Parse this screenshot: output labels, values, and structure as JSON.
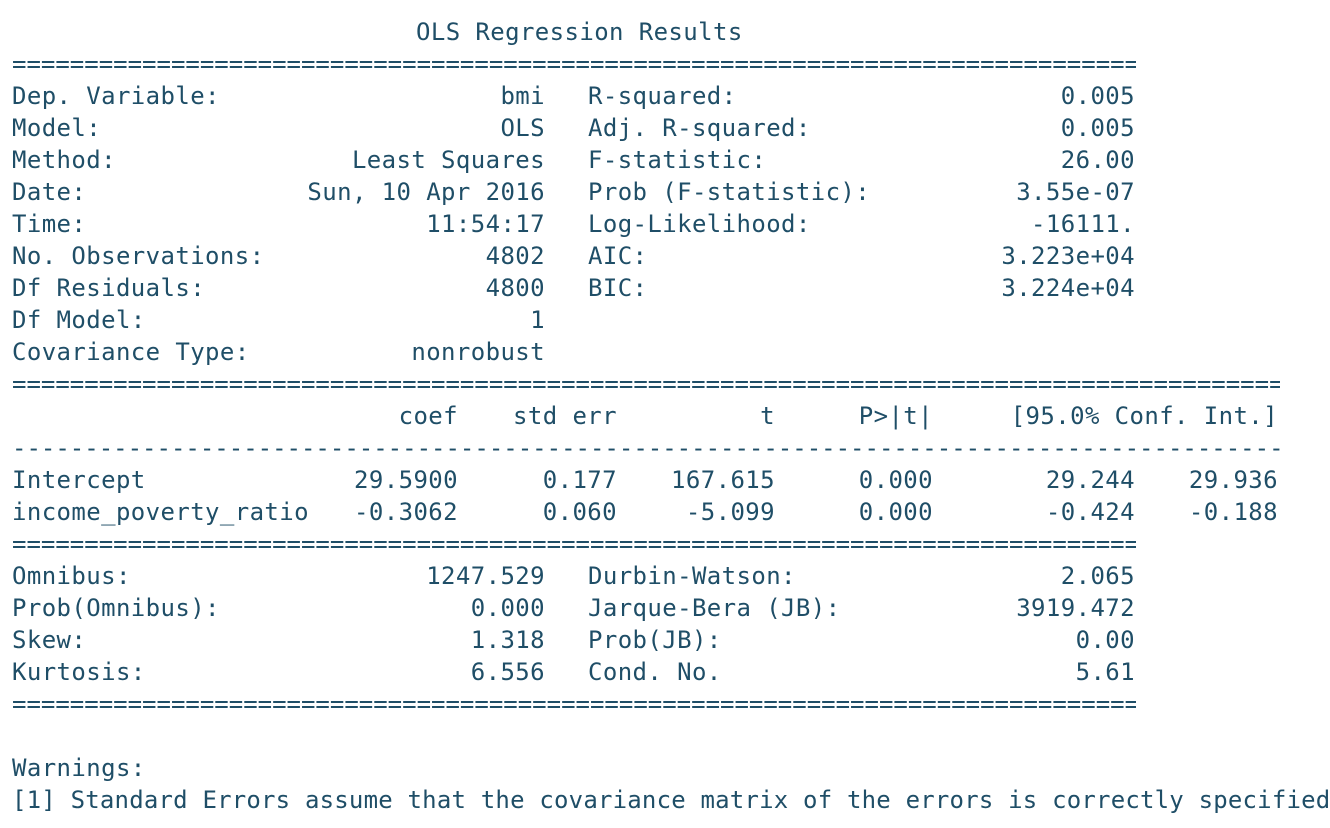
{
  "title": "OLS Regression Results",
  "separators": {
    "double_short": "==============================================================================",
    "double_long": "=========================================================================================",
    "dash_long": "-----------------------------------------------------------------------------------------"
  },
  "model_info": {
    "rows": [
      {
        "label": "Dep. Variable:",
        "value": "bmi",
        "stat_label": "R-squared:",
        "stat_value": "0.005"
      },
      {
        "label": "Model:",
        "value": "OLS",
        "stat_label": "Adj. R-squared:",
        "stat_value": "0.005"
      },
      {
        "label": "Method:",
        "value": "Least Squares",
        "stat_label": "F-statistic:",
        "stat_value": "26.00"
      },
      {
        "label": "Date:",
        "value": "Sun, 10 Apr 2016",
        "stat_label": "Prob (F-statistic):",
        "stat_value": "3.55e-07"
      },
      {
        "label": "Time:",
        "value": "11:54:17",
        "stat_label": "Log-Likelihood:",
        "stat_value": "-16111."
      },
      {
        "label": "No. Observations:",
        "value": "4802",
        "stat_label": "AIC:",
        "stat_value": "3.223e+04"
      },
      {
        "label": "Df Residuals:",
        "value": "4800",
        "stat_label": "BIC:",
        "stat_value": "3.224e+04"
      },
      {
        "label": "Df Model:",
        "value": "1",
        "stat_label": "",
        "stat_value": ""
      },
      {
        "label": "Covariance Type:",
        "value": "nonrobust",
        "stat_label": "",
        "stat_value": ""
      }
    ]
  },
  "coef_table": {
    "headers": [
      "coef",
      "std err",
      "t",
      "P>|t|",
      "[95.0% Conf. Int.]"
    ],
    "rows": [
      {
        "name": "Intercept",
        "coef": "29.5900",
        "std_err": "0.177",
        "t": "167.615",
        "p": "0.000",
        "ci_low": "29.244",
        "ci_high": "29.936"
      },
      {
        "name": "income_poverty_ratio",
        "coef": "-0.3062",
        "std_err": "0.060",
        "t": "-5.099",
        "p": "0.000",
        "ci_low": "-0.424",
        "ci_high": "-0.188"
      }
    ]
  },
  "diagnostics": {
    "rows": [
      {
        "label": "Omnibus:",
        "value": "1247.529",
        "stat_label": "Durbin-Watson:",
        "stat_value": "2.065"
      },
      {
        "label": "Prob(Omnibus):",
        "value": "0.000",
        "stat_label": "Jarque-Bera (JB):",
        "stat_value": "3919.472"
      },
      {
        "label": "Skew:",
        "value": "1.318",
        "stat_label": "Prob(JB):",
        "stat_value": "0.00"
      },
      {
        "label": "Kurtosis:",
        "value": "6.556",
        "stat_label": "Cond. No.",
        "stat_value": "5.61"
      }
    ]
  },
  "warnings": {
    "heading": "Warnings:",
    "items": [
      "[1] Standard Errors assume that the covariance matrix of the errors is correctly specified."
    ]
  },
  "colors": {
    "text": "#1f4e67",
    "background": "#ffffff"
  }
}
